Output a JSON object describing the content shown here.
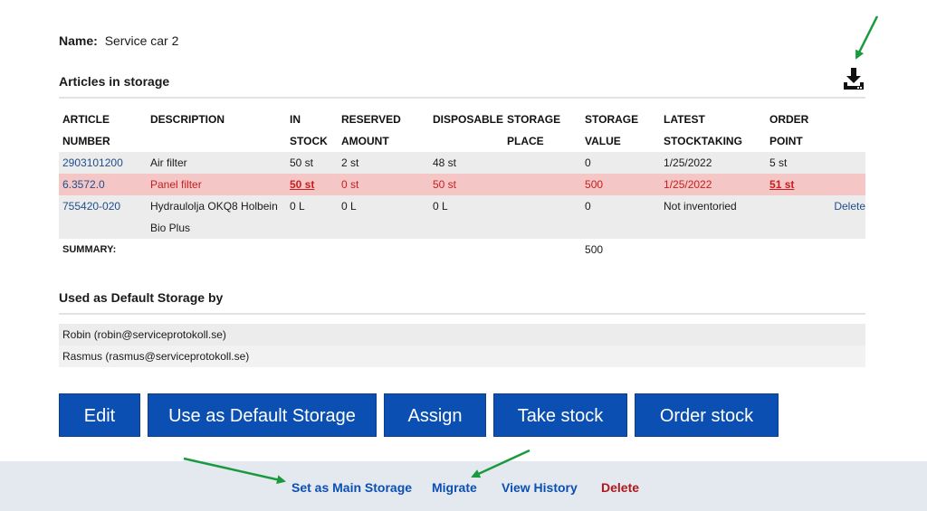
{
  "name": {
    "label": "Name:",
    "value": "Service car 2"
  },
  "articles_title": "Articles in storage",
  "table": {
    "headers": [
      [
        "ARTICLE",
        "NUMBER"
      ],
      [
        "DESCRIPTION",
        ""
      ],
      [
        "IN",
        "STOCK"
      ],
      [
        "RESERVED",
        "AMOUNT"
      ],
      [
        "DISPOSABLE",
        ""
      ],
      [
        "STORAGE",
        "PLACE"
      ],
      [
        "STORAGE",
        "VALUE"
      ],
      [
        "LATEST",
        "STOCKTAKING"
      ],
      [
        "ORDER",
        "POINT"
      ]
    ],
    "rows": [
      {
        "article": "2903101200",
        "description": "Air filter",
        "in_stock": "50 st",
        "reserved": "2 st",
        "disposable": "48 st",
        "place": "",
        "value": "0",
        "stocktaking": "1/25/2022",
        "order_point": "5 st",
        "action": ""
      },
      {
        "article": "6.3572.0",
        "description": "Panel filter",
        "in_stock": "50 st",
        "reserved": "0 st",
        "disposable": "50 st",
        "place": "",
        "value": "500",
        "stocktaking": "1/25/2022",
        "order_point": "51 st",
        "action": ""
      },
      {
        "article": "755420-020",
        "description": "Hydraulolja OKQ8 Holbein Bio Plus",
        "in_stock": "0 L",
        "reserved": "0 L",
        "disposable": "0 L",
        "place": "",
        "value": "0",
        "stocktaking": "Not inventoried",
        "order_point": "",
        "action": "Delete"
      }
    ],
    "summary_label": "SUMMARY:",
    "summary_value": "500"
  },
  "default_storage_title": "Used as Default Storage by",
  "default_users": [
    "Robin (robin@serviceprotokoll.se)",
    "Rasmus (rasmus@serviceprotokoll.se)"
  ],
  "buttons": {
    "edit": "Edit",
    "default_storage": "Use as Default Storage",
    "assign": "Assign",
    "take_stock": "Take stock",
    "order_stock": "Order stock"
  },
  "footer": {
    "main_storage": "Set as Main Storage",
    "migrate": "Migrate",
    "history": "View History",
    "delete": "Delete"
  },
  "colors": {
    "primary_button": "#0b4fb3",
    "link": "#1f4e8c",
    "alert_row": "#f5c6c6",
    "alert_text": "#c81e1e",
    "danger": "#b3171d",
    "arrow": "#1a9a3e"
  },
  "icons": {
    "download": "download-icon"
  }
}
